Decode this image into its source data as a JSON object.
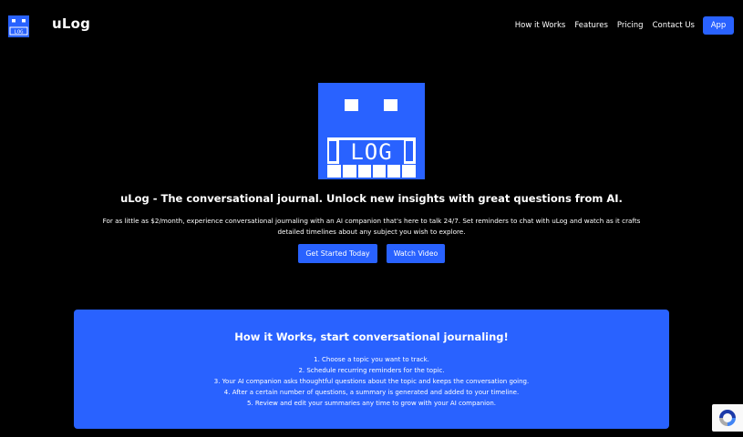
{
  "header": {
    "logo_text": "LOG",
    "brand": "uLog",
    "nav": [
      {
        "label": "How it Works"
      },
      {
        "label": "Features"
      },
      {
        "label": "Pricing"
      },
      {
        "label": "Contact Us"
      }
    ],
    "app_button": "App"
  },
  "hero": {
    "logo_text": "LOG",
    "title": "uLog - The conversational journal. Unlock new insights with great questions from AI.",
    "description": "For as little as $2/month, experience conversational journaling with an AI companion that's here to talk 24/7. Set reminders to chat with uLog and watch as it crafts detailed timelines about any subject you wish to explore.",
    "buttons": {
      "start": "Get Started Today",
      "video": "Watch Video"
    }
  },
  "how_it_works": {
    "title": "How it Works, start conversational journaling!",
    "steps": [
      "1. Choose a topic you want to track.",
      "2. Schedule recurring reminders for the topic.",
      "3. Your AI companion asks thoughtful questions about the topic and keeps the conversation going.",
      "4. After a certain number of questions, a summary is generated and added to your timeline.",
      "5. Review and edit your summaries any time to grow with your AI companion."
    ]
  },
  "colors": {
    "accent": "#2962ff",
    "background": "#000000"
  },
  "icons": {
    "brand_logo": "ulog-robot-logo-icon",
    "recaptcha": "recaptcha-icon"
  }
}
